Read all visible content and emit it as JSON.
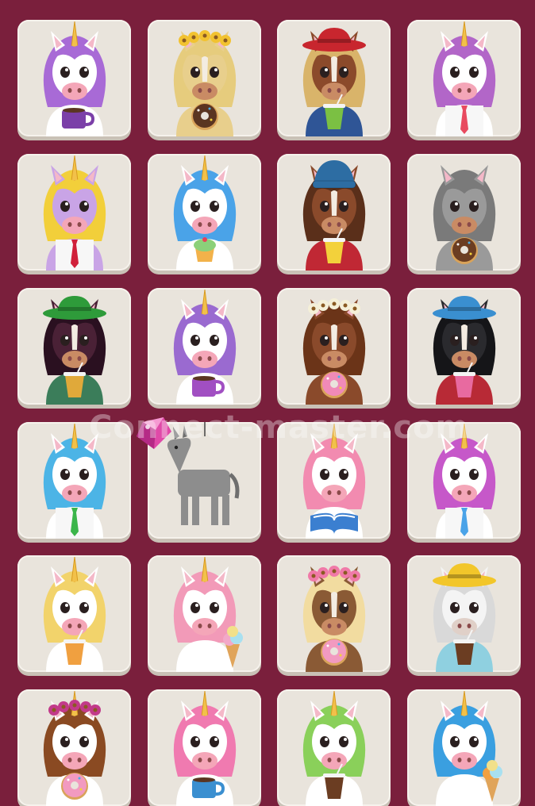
{
  "game": {
    "watermark": "Connect-master.com"
  },
  "colors": {
    "background": "#7a1f3c",
    "tile": "#e9e4dc",
    "tile_shadow": "#c9c1b6"
  },
  "tiles": [
    {
      "name": "tile-purple-unicorn-coffee",
      "kind": "unicorn",
      "fur": "#ffffff",
      "mane": "#a86ad6",
      "prop": "mug",
      "propColor": "#7b3fa8"
    },
    {
      "name": "tile-horse-sunflower-donut",
      "kind": "horse",
      "fur": "#e8cf8c",
      "mane": "#e6cc7d",
      "hat": "flowers",
      "hatColor": "#f2c230",
      "prop": "donut",
      "propColor": "#5a3521"
    },
    {
      "name": "tile-horse-red-hat-drink",
      "kind": "horse",
      "fur": "#8b4a2b",
      "mane": "#d9b46a",
      "hat": "hat",
      "hatColor": "#c8262e",
      "prop": "cup",
      "propColor": "#7bc043",
      "shirt": "#2f5596"
    },
    {
      "name": "tile-white-unicorn-rainbow-tie",
      "kind": "unicorn",
      "fur": "#ffffff",
      "mane": "#b266c8",
      "prop": "tie",
      "propColor": "#e84a5f"
    },
    {
      "name": "tile-lilac-unicorn-red-tie",
      "kind": "unicorn",
      "fur": "#c9a4e6",
      "mane": "#f2cf3a",
      "prop": "tie",
      "propColor": "#d0203a"
    },
    {
      "name": "tile-blue-unicorn-cupcake",
      "kind": "unicorn",
      "fur": "#ffffff",
      "mane": "#4aa3e8",
      "prop": "cupcake",
      "propColor": "#8bd07a"
    },
    {
      "name": "tile-horse-beanie-scarf",
      "kind": "horse",
      "fur": "#8a4a2b",
      "mane": "#5a2f1a",
      "hat": "beanie",
      "hatColor": "#2d6da3",
      "prop": "cup",
      "propColor": "#f3d13b",
      "shirt": "#c02834"
    },
    {
      "name": "tile-gray-horse-donut",
      "kind": "horse",
      "fur": "#9a9a9a",
      "mane": "#7a7a7a",
      "prop": "donut",
      "propColor": "#6b3d22"
    },
    {
      "name": "tile-dark-horse-green-hat",
      "kind": "horse",
      "fur": "#4a2136",
      "mane": "#2a1020",
      "hat": "hat",
      "hatColor": "#2e9b3a",
      "prop": "cup",
      "propColor": "#e0a93a",
      "shirt": "#3b7d5a"
    },
    {
      "name": "tile-white-unicorn-purple-mug",
      "kind": "unicorn",
      "fur": "#ffffff",
      "mane": "#9a6ad0",
      "prop": "mug",
      "propColor": "#a14fc2"
    },
    {
      "name": "tile-horse-daisy-donut",
      "kind": "horse",
      "fur": "#8a4a2b",
      "mane": "#6b3418",
      "hat": "flowers",
      "hatColor": "#f5f0d8",
      "prop": "donut",
      "propColor": "#f08ab8"
    },
    {
      "name": "tile-black-horse-blue-hat",
      "kind": "horse",
      "fur": "#2a2a2e",
      "mane": "#151518",
      "hat": "hat",
      "hatColor": "#3a8fd0",
      "prop": "cup",
      "propColor": "#e86aa0",
      "shirt": "#b82a36"
    },
    {
      "name": "tile-blue-unicorn-green-tie",
      "kind": "unicorn",
      "fur": "#ffffff",
      "mane": "#4cb4e6",
      "prop": "tie",
      "propColor": "#3bb54a"
    },
    {
      "name": "tile-gray-pinata",
      "kind": "pinata",
      "fur": "#8d8d8d",
      "mane": "#6e6e6e",
      "prop": "none",
      "propColor": "#000000"
    },
    {
      "name": "tile-rainbow-unicorn-book",
      "kind": "unicorn",
      "fur": "#ffffff",
      "mane": "#f28bb0",
      "prop": "book",
      "propColor": "#3b7fd0"
    },
    {
      "name": "tile-pink-mane-unicorn-blue-tie",
      "kind": "unicorn",
      "fur": "#ffffff",
      "mane": "#c658c9",
      "prop": "tie",
      "propColor": "#4aa3e8"
    },
    {
      "name": "tile-blonde-unicorn-rainbow-cup",
      "kind": "unicorn",
      "fur": "#ffffff",
      "mane": "#f2d36b",
      "prop": "cup",
      "propColor": "#f0a040"
    },
    {
      "name": "tile-pastel-unicorn-ice-cream",
      "kind": "unicorn",
      "fur": "#ffffff",
      "mane": "#f29ab8",
      "prop": "icecream",
      "propColor": "#f2a8c8"
    },
    {
      "name": "tile-blonde-horse-flower-donut",
      "kind": "horse",
      "fur": "#8a5a35",
      "mane": "#f2dca0",
      "hat": "flowers",
      "hatColor": "#f07aa8",
      "prop": "donut",
      "propColor": "#f29ac0"
    },
    {
      "name": "tile-white-horse-yellow-hat",
      "kind": "horse",
      "fur": "#f4f4f4",
      "mane": "#d9d9d9",
      "hat": "hat",
      "hatColor": "#f2c62a",
      "prop": "cup",
      "propColor": "#6b3d22",
      "shirt": "#8fd0e0"
    },
    {
      "name": "tile-brown-mane-unicorn-donut",
      "kind": "unicorn",
      "fur": "#ffffff",
      "mane": "#8a4a22",
      "prop": "donut",
      "propColor": "#f29ac0",
      "hat": "flowers",
      "hatColor": "#c23a8a"
    },
    {
      "name": "tile-pink-unicorn-blue-mug",
      "kind": "unicorn",
      "fur": "#ffffff",
      "mane": "#f07ab0",
      "prop": "mug",
      "propColor": "#3b8fd0"
    },
    {
      "name": "tile-rainbow-unicorn-coffee",
      "kind": "unicorn",
      "fur": "#ffffff",
      "mane": "#8ad05a",
      "prop": "cup",
      "propColor": "#6b3d22"
    },
    {
      "name": "tile-blue-unicorn-ice-cream",
      "kind": "unicorn",
      "fur": "#ffffff",
      "mane": "#3a9fe0",
      "prop": "icecream",
      "propColor": "#f2a040"
    }
  ]
}
